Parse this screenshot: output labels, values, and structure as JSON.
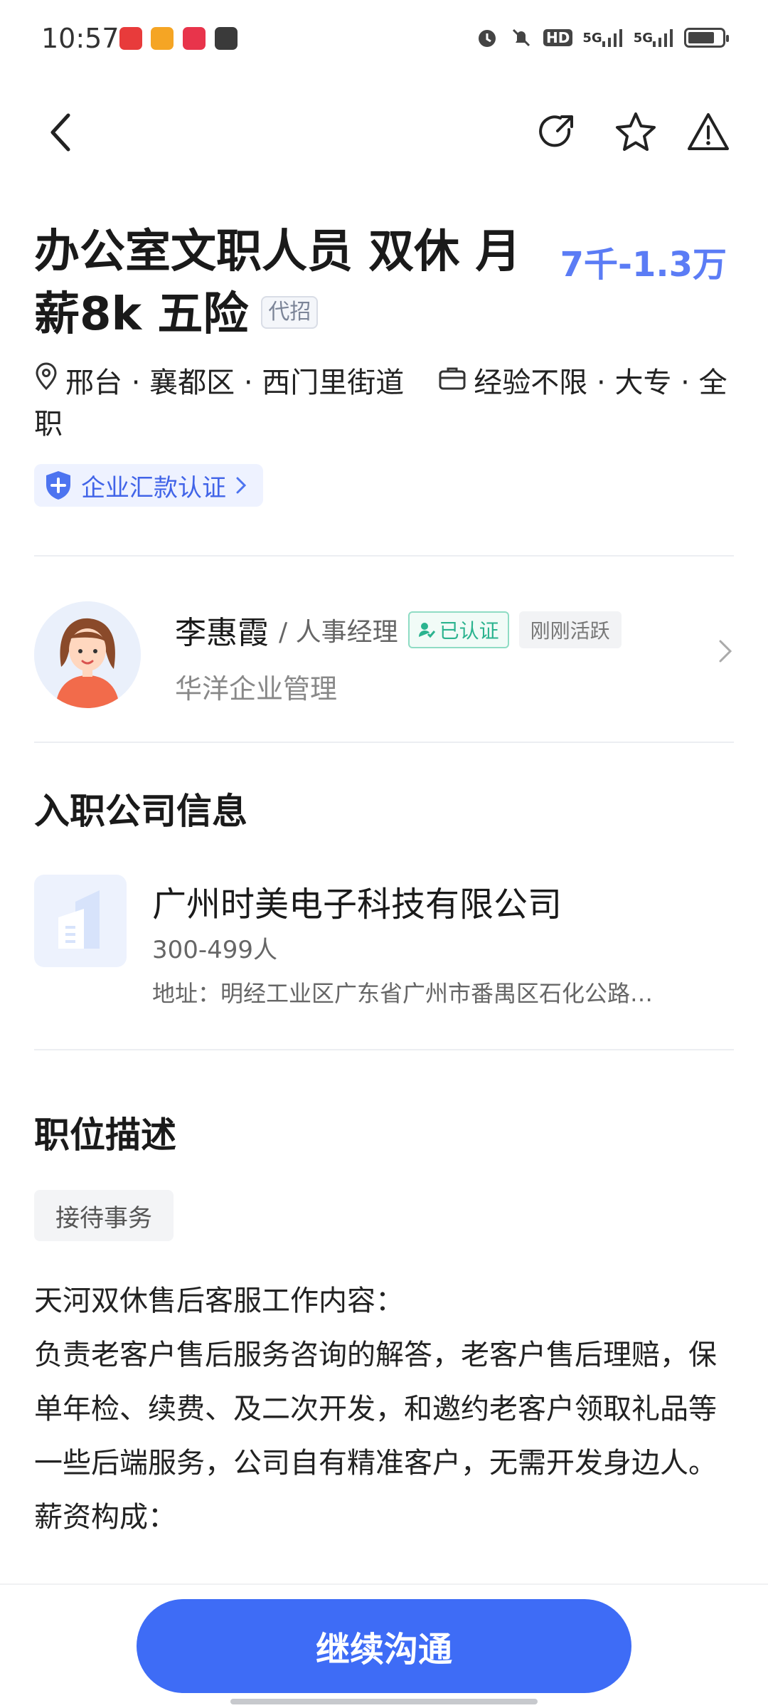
{
  "status_bar": {
    "time": "10:57",
    "app_icons": [
      {
        "icon": "app-red-icon",
        "color": "#e83b3b"
      },
      {
        "icon": "app-orange-play-icon",
        "color": "#f5a524"
      },
      {
        "icon": "app-red-book-icon",
        "color": "#e8344b"
      },
      {
        "icon": "app-dark-message-icon",
        "color": "#3a3a3a"
      }
    ],
    "hd_label": "HD",
    "signal_1": "5G",
    "signal_2": "5G"
  },
  "nav": {
    "back_icon": "chevron-left-icon",
    "share_icon": "share-icon",
    "favorite_icon": "star-icon",
    "report_icon": "warning-icon"
  },
  "job": {
    "title": "办公室文职人员 双休 月薪8k 五险",
    "proxy_tag": "代招",
    "salary": "7千-1.3万",
    "location": "邢台 · 襄都区 · 西门里街道",
    "requirements": "经验不限 · 大专 · 全职",
    "verify_label": "企业汇款认证",
    "accent_color": "#5b7cf5"
  },
  "recruiter": {
    "name": "李惠霞",
    "role": "/ 人事经理",
    "verified_badge": "已认证",
    "active_badge": "刚刚活跃",
    "company": "华洋企业管理"
  },
  "company_section": {
    "heading": "入职公司信息",
    "name": "广州时美电子科技有限公司",
    "size": "300-499人",
    "address": "地址：明经工业区广东省广州市番禺区石化公路…"
  },
  "description_section": {
    "heading": "职位描述",
    "tag": "接待事务",
    "lines": [
      "天河双休售后客服工作内容：",
      "负责老客户售后服务咨询的解答，老客户售后理赔，保单年检、续费、及二次开发，和邀约老客户领取礼品等一些后端服务，公司自有精准客户，无需开发身边人。",
      "薪资构成："
    ]
  },
  "cta": {
    "label": "继续沟通",
    "color": "#3e6cf6"
  }
}
